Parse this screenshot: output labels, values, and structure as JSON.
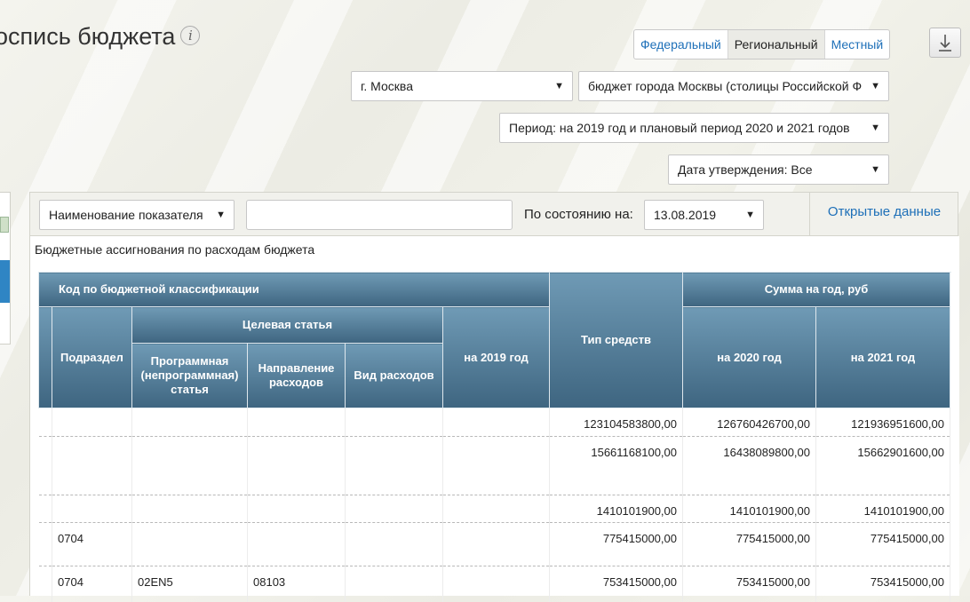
{
  "page": {
    "title": "оспись бюджета",
    "info_icon": "i"
  },
  "levels": [
    {
      "label": "Федеральный",
      "active": false
    },
    {
      "label": "Региональный",
      "active": true
    },
    {
      "label": "Местный",
      "active": false
    }
  ],
  "selects": {
    "region": "г. Москва",
    "budget": "бюджет города Москвы (столицы Российской Ф",
    "period": "Период: на 2019 год и плановый период 2020 и 2021 годов",
    "approval_date": "Дата утверждения: Все",
    "indicator": "Наименование показателя",
    "state_date": "13.08.2019"
  },
  "filter": {
    "search_value": "",
    "state_label": "По состоянию на:",
    "open_data_label": "Открытые данные"
  },
  "section_title": "Бюджетные ассигнования по расходам бюджета",
  "table": {
    "headers": {
      "code_group": "Код по бюджетной классификации",
      "subsection": "Подраздел",
      "target_article": "Целевая статья",
      "program_article": "Программная (непрограммная) статья",
      "direction": "Направление расходов",
      "expense_type": "Вид расходов",
      "fund_type": "Тип средств",
      "sum_group": "Сумма на год, руб",
      "y2019": "на 2019 год",
      "y2020": "на 2020 год",
      "y2021": "на 2021 год"
    },
    "rows": [
      {
        "subsection": "",
        "program": "",
        "direction": "",
        "expense": "",
        "fund": "",
        "y2019": "123104583800,00",
        "y2020": "126760426700,00",
        "y2021": "121936951600,00"
      },
      {
        "subsection": "",
        "program": "",
        "direction": "",
        "expense": "",
        "fund": "",
        "y2019": "15661168100,00",
        "y2020": "16438089800,00",
        "y2021": "15662901600,00"
      },
      {
        "subsection": "",
        "program": "",
        "direction": "",
        "expense": "",
        "fund": "",
        "y2019": "1410101900,00",
        "y2020": "1410101900,00",
        "y2021": "1410101900,00"
      },
      {
        "subsection": "0704",
        "program": "",
        "direction": "",
        "expense": "",
        "fund": "",
        "y2019": "775415000,00",
        "y2020": "775415000,00",
        "y2021": "775415000,00"
      },
      {
        "subsection": "0704",
        "program": "02EN5",
        "direction": "08103",
        "expense": "",
        "fund": "",
        "y2019": "753415000,00",
        "y2020": "753415000,00",
        "y2021": "753415000,00"
      }
    ]
  },
  "colors": {
    "link": "#1d6fb8",
    "header_top": "#6f9ab5",
    "header_bottom": "#3e6580",
    "panel_accent": "#2f85c4"
  }
}
